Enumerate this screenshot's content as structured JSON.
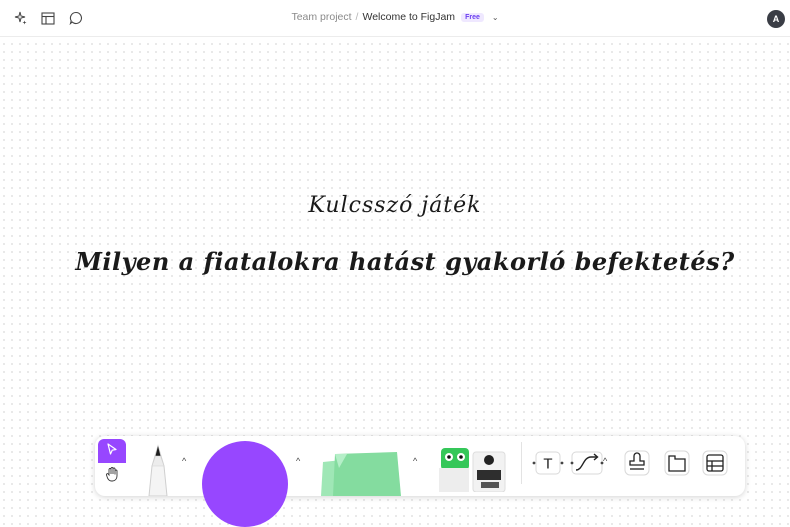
{
  "topbar": {
    "icons": [
      "sparkle-icon",
      "layout-icon",
      "comment-icon"
    ],
    "breadcrumb": {
      "project": "Team project",
      "separator": "/",
      "file": "Welcome to FigJam",
      "plan_badge": "Free",
      "chevron": "⌄"
    },
    "avatar": "A"
  },
  "canvas": {
    "subtitle": "Kulcsszó játék",
    "question": "Milyen a fiatalokra hatást gyakorló befektetés?"
  },
  "toolbar": {
    "tools": [
      "select-icon",
      "hand-icon",
      "marker-icon",
      "shape-icon",
      "sticky-note-icon",
      "stickers-icon",
      "text-icon",
      "connector-icon",
      "stamp-icon",
      "section-icon",
      "table-icon"
    ],
    "caret": "^",
    "text_glyph": "T",
    "colors": {
      "accent": "#9747ff",
      "sticky": "#8ee0a8"
    }
  }
}
